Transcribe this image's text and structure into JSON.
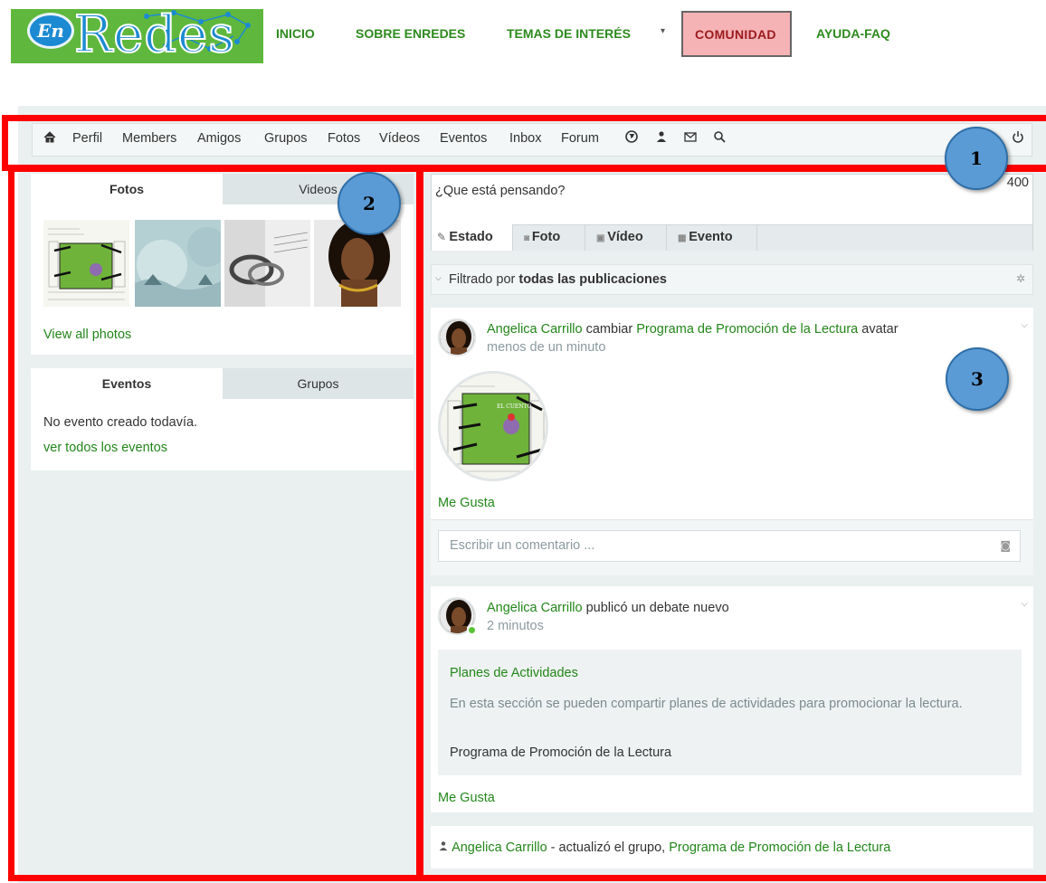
{
  "site": {
    "logo": {
      "mark": "En",
      "word": "Redes"
    },
    "nav": [
      "INICIO",
      "SOBRE ENREDES",
      "TEMAS DE INTERÉS",
      "COMUNIDAD",
      "AYUDA-FAQ"
    ],
    "nav_dropdown_glyph": "▾"
  },
  "toolbar": {
    "items": [
      "Perfil",
      "Members",
      "Amigos",
      "Grupos",
      "Fotos",
      "Vídeos",
      "Eventos",
      "Inbox",
      "Forum"
    ]
  },
  "left": {
    "media_tabs": [
      "Fotos",
      "Videos"
    ],
    "view_all_photos": "View all photos",
    "event_tabs": [
      "Eventos",
      "Grupos"
    ],
    "no_events": "No evento creado todavía.",
    "see_all_events": "ver todos los eventos"
  },
  "composer": {
    "placeholder": "¿Que está pensando?",
    "counter": "400",
    "tabs": [
      "Estado",
      "Foto",
      "Vídeo",
      "Evento"
    ]
  },
  "filter": {
    "prefix": "Filtrado por ",
    "value": "todas las publicaciones"
  },
  "posts": [
    {
      "author": "Angelica Carrillo",
      "verb": " cambiar ",
      "target": "Programa de Promoción de la Lectura",
      "suffix": " avatar",
      "time": "menos de un minuto",
      "like": "Me Gusta",
      "comment_placeholder": "Escribir un comentario ..."
    },
    {
      "author": "Angelica Carrillo",
      "verb": " publicó un debate nuevo",
      "time": "2 minutos",
      "debate_title": "Planes de Actividades",
      "debate_body": "En esta sección se pueden compartir planes de actividades para promocionar la lectura.",
      "debate_group": "Programa de Promoción de la Lectura",
      "like": "Me Gusta"
    },
    {
      "author": "Angelica Carrillo",
      "middle": " - actualizó el grupo, ",
      "target": "Programa de Promoción de la Lectura"
    }
  ],
  "callouts": [
    "1",
    "2",
    "3"
  ],
  "colors": {
    "accent_green": "#23861a",
    "nav_green": "#2d8a1e",
    "highlight_red": "#ff0000",
    "badge_blue": "#5b9bd5"
  }
}
